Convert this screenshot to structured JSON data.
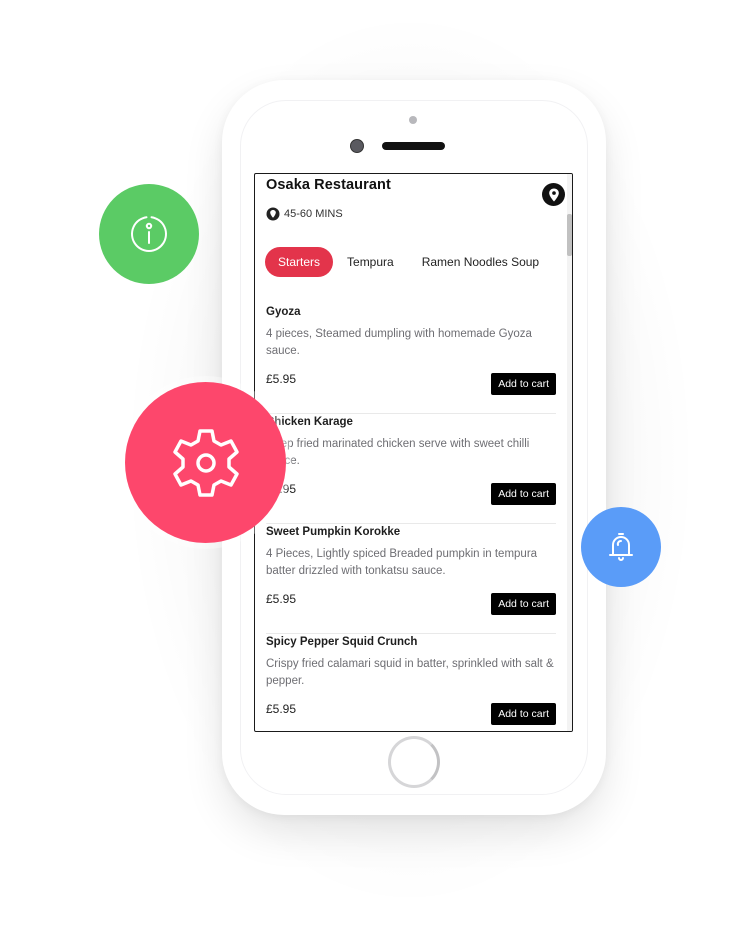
{
  "restaurant": {
    "name": "Osaka Restaurant",
    "delivery_time": "45-60 MINS",
    "map_icon": "map-pin-icon",
    "eta_icon": "location-pin-icon"
  },
  "tabs": [
    {
      "label": "Starters",
      "active": true
    },
    {
      "label": "Tempura",
      "active": false
    },
    {
      "label": "Ramen Noodles Soup",
      "active": false
    }
  ],
  "menu_items": [
    {
      "name": "Gyoza",
      "description": "4 pieces, Steamed dumpling with homemade Gyoza sauce.",
      "price": "£5.95",
      "button": "Add to cart"
    },
    {
      "name": "Chicken Karage",
      "description": "Deep fried marinated chicken serve with sweet chilli sauce.",
      "price": "£5.95",
      "button": "Add to cart"
    },
    {
      "name": "Sweet Pumpkin Korokke",
      "description": "4 Pieces, Lightly spiced Breaded pumpkin in tempura batter drizzled with tonkatsu sauce.",
      "price": "£5.95",
      "button": "Add to cart"
    },
    {
      "name": "Spicy Pepper Squid Crunch",
      "description": "Crispy fried calamari squid in batter, sprinkled with salt & pepper.",
      "price": "£5.95",
      "button": "Add to cart"
    }
  ],
  "floating_buttons": {
    "info": {
      "icon": "info-icon",
      "color": "#5bcb65"
    },
    "settings": {
      "icon": "gear-icon",
      "color": "#fd476c"
    },
    "notifications": {
      "icon": "bell-icon",
      "color": "#5a9cf8"
    }
  },
  "colors": {
    "accent": "#e3344b",
    "button_bg": "#000000"
  }
}
